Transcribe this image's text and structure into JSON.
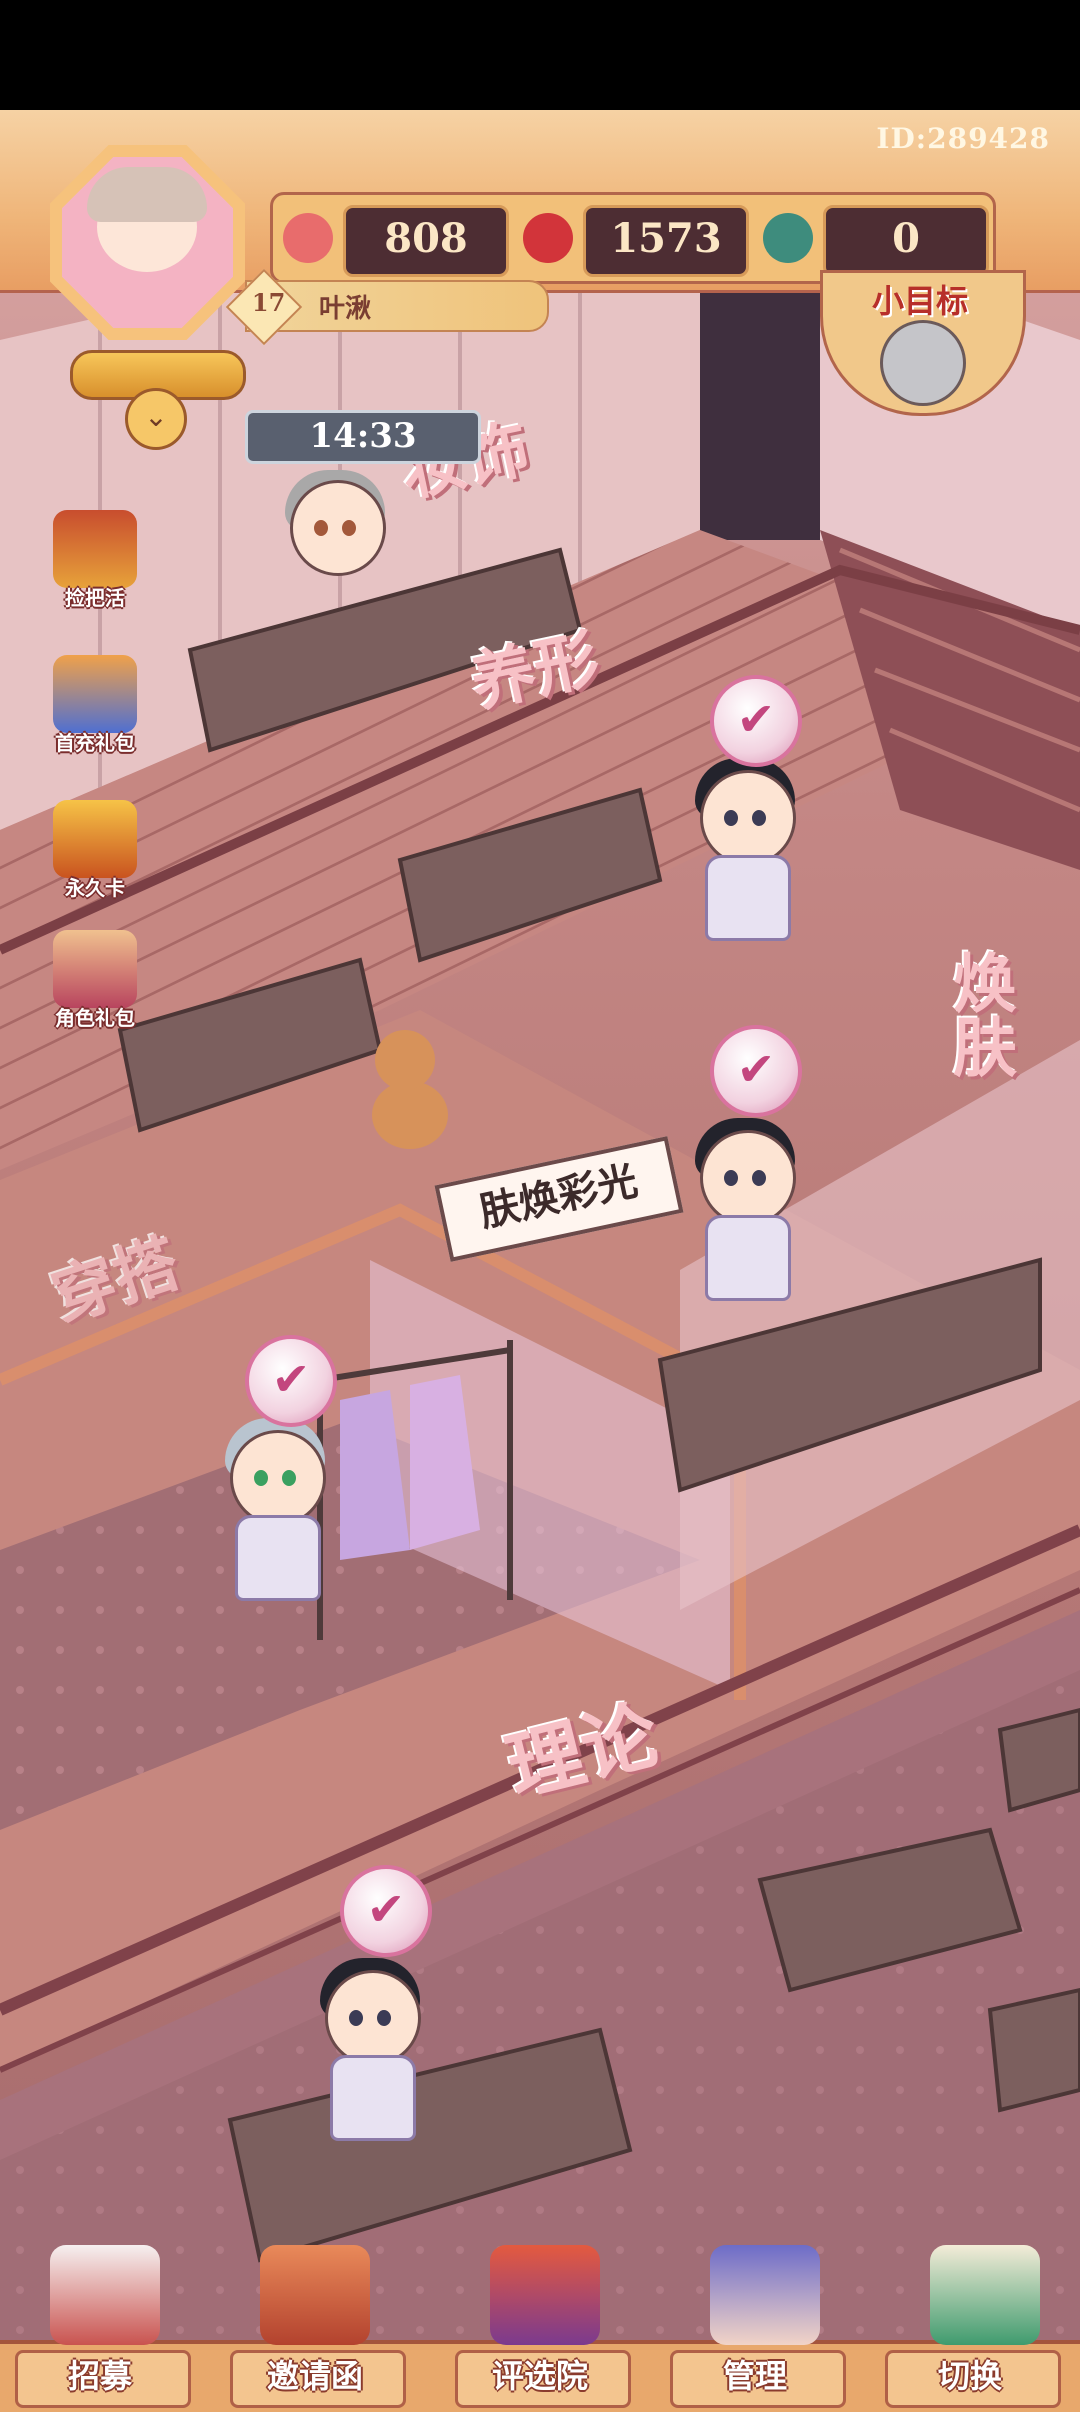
{
  "hud": {
    "player_id": "ID:289428",
    "player_level": "17",
    "player_name": "叶湫",
    "resources": [
      {
        "icon": "heart-shell-icon",
        "value": "808"
      },
      {
        "icon": "red-jewel-icon",
        "value": "1573"
      },
      {
        "icon": "jade-orb-icon",
        "value": "0"
      }
    ],
    "goal_label": "小目标"
  },
  "timer": "14:33",
  "side_buttons": [
    {
      "name": "捡把活",
      "icon": "treasure-chest-icon"
    },
    {
      "name": "首充礼包",
      "icon": "fox-gift-icon"
    },
    {
      "name": "永久卡",
      "icon": "gold-card-icon"
    },
    {
      "name": "角色礼包",
      "icon": "character-gift-icon"
    }
  ],
  "zones": {
    "makeup": "妆饰",
    "posture": "养形",
    "costume": "穿搭",
    "skincare": "焕肤",
    "theory": "理论"
  },
  "shop_sign": "肤焕彩光",
  "bottom_nav": [
    {
      "label": "招募",
      "icon": "recruit-house-icon"
    },
    {
      "label": "邀请函",
      "icon": "invitation-letter-icon"
    },
    {
      "label": "评选院",
      "icon": "pavilion-icon"
    },
    {
      "label": "管理",
      "icon": "manager-character-icon"
    },
    {
      "label": "切换",
      "icon": "map-pin-icon"
    }
  ],
  "colors": {
    "hud_bg": "#efb579",
    "resource_slot": "#4d2d33",
    "check_pink": "#d9739e",
    "nav_strip": "#e8a86c"
  }
}
